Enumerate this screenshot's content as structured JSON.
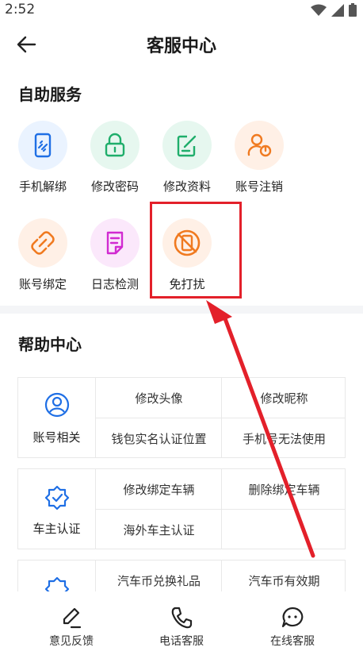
{
  "status_bar": {
    "time": "2:52"
  },
  "nav": {
    "title": "客服中心"
  },
  "self_service": {
    "title": "自助服务",
    "items": [
      {
        "label": "手机解绑",
        "icon": "phone-unlink-icon",
        "bg": "#eaf3ff",
        "color": "#1f6fe5"
      },
      {
        "label": "修改密码",
        "icon": "lock-icon",
        "bg": "#e6f7ef",
        "color": "#1fae6b"
      },
      {
        "label": "修改资料",
        "icon": "edit-profile-icon",
        "bg": "#e6f7ef",
        "color": "#1fae6b"
      },
      {
        "label": "账号注销",
        "icon": "account-cancel-icon",
        "bg": "#fff0e6",
        "color": "#f07a20"
      },
      {
        "label": "账号绑定",
        "icon": "link-icon",
        "bg": "#fff0e6",
        "color": "#f07a20"
      },
      {
        "label": "日志检测",
        "icon": "log-icon",
        "bg": "#fbe8fb",
        "color": "#d12ad1"
      },
      {
        "label": "免打扰",
        "icon": "do-not-disturb-icon",
        "bg": "#fff0e6",
        "color": "#f07a20"
      }
    ]
  },
  "help_center": {
    "title": "帮助中心",
    "groups": [
      {
        "label": "账号相关",
        "icon": "user-icon",
        "items": [
          "修改头像",
          "修改昵称",
          "钱包实名认证位置",
          "手机号无法使用"
        ]
      },
      {
        "label": "车主认证",
        "icon": "verified-badge-icon",
        "items": [
          "修改绑定车辆",
          "删除绑定车辆",
          "海外车主认证",
          ""
        ]
      },
      {
        "label": "",
        "icon": "coin-badge-icon",
        "items": [
          "汽车币兑换礼品",
          "汽车币有效期"
        ]
      }
    ]
  },
  "bottom_bar": {
    "tabs": [
      {
        "label": "意见反馈",
        "icon": "feedback-icon"
      },
      {
        "label": "电话客服",
        "icon": "phone-icon"
      },
      {
        "label": "在线客服",
        "icon": "chat-icon"
      }
    ]
  },
  "colors": {
    "accent": "#1f6fe5",
    "highlight": "#e3202a"
  }
}
